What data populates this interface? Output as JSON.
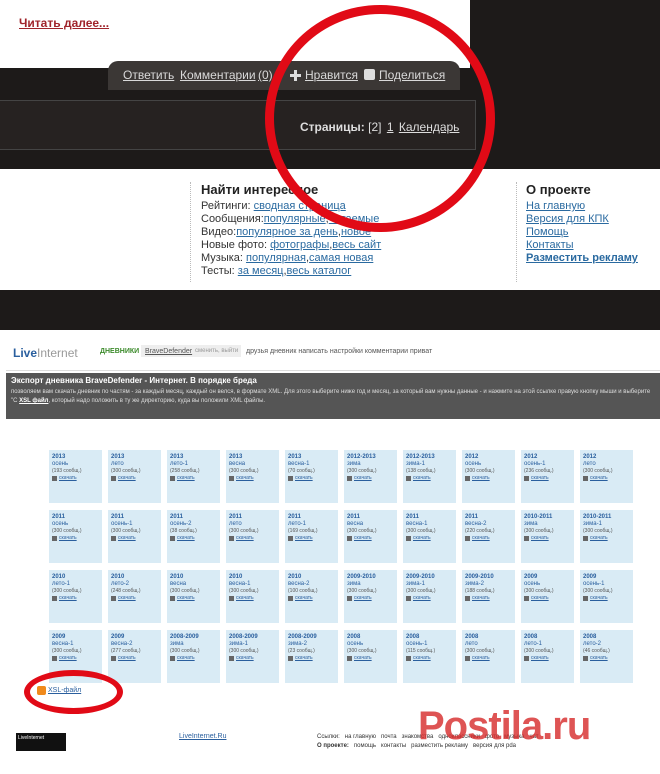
{
  "top": {
    "read_more": "Читать далее...",
    "actions": {
      "reply": "Ответить",
      "comments": "Комментарии",
      "count": "(0)",
      "like": "Нравится",
      "share": "Поделиться"
    },
    "pager": {
      "label": "Страницы:",
      "current": "[2]",
      "page1": "1",
      "calendar": "Календарь"
    },
    "find": {
      "title": "Найти интересное",
      "ratings_label": "Рейтинги:",
      "ratings_link": "сводная страница",
      "posts_label": "Сообщения:",
      "posts_link1": "популярные",
      "posts_link2": "читаемые",
      "video_label": "Видео:",
      "video_link1": "популярное за день",
      "video_link2": "новое",
      "photo_label": "Новые фото:",
      "photo_link1": "фотографы",
      "photo_link2": "весь сайт",
      "music_label": "Музыка:",
      "music_link1": "популярная",
      "music_link2": "самая новая",
      "tests_label": "Тесты:",
      "tests_link1": "за месяц",
      "tests_link2": "весь каталог"
    },
    "about": {
      "title": "О проекте",
      "items": [
        "На главную",
        "Версия для КПК",
        "Помощь",
        "Контакты",
        "Разместить рекламу"
      ]
    }
  },
  "li": {
    "logo_a": "Live",
    "logo_b": "Internet",
    "diaries": "ДНЕВНИКИ",
    "user": "BraveDefender",
    "exit": "сменить, выйти",
    "nav": "друзья дневник написать настройки комментарии приват",
    "export_title": "Экспорт дневника BraveDefender - Интернет. В порядке бреда",
    "export_desc_a": "позволяем вам скачать дневник по частям - за каждый месяц, каждый он велся, в формате XML. Для этого выберите ниже год и месяц, за который вам нужны данные - и нажмите на этой ссылке правую кнопку мыши и выберите \"С",
    "export_desc_b": "XSL файл",
    "export_desc_c": ", который надо положить в ту же директорию, куда вы положили XML файлы.",
    "xsl": "XSL-файл",
    "counter": "LiveInternet",
    "footer_link": "LiveInternet.Ru",
    "footer_row1": [
      "Ссылки:",
      "на главную",
      "почта",
      "знакомства",
      "одноклассники",
      "фото",
      "музыка",
      "чат"
    ],
    "footer_row2": [
      "О проекте:",
      "помощь",
      "контакты",
      "разместить рекламу",
      "версия для pda"
    ]
  },
  "grid": [
    [
      {
        "y": "2013",
        "s": "осень",
        "c": "(193 сообщ.)"
      },
      {
        "y": "2013",
        "s": "лето",
        "c": "(300 сообщ.)"
      },
      {
        "y": "2013",
        "s": "лето-1",
        "c": "(258 сообщ.)"
      },
      {
        "y": "2013",
        "s": "весна",
        "c": "(300 сообщ.)"
      },
      {
        "y": "2013",
        "s": "весна-1",
        "c": "(70 сообщ.)"
      },
      {
        "y": "2012-2013",
        "s": "зима",
        "c": "(300 сообщ.)"
      },
      {
        "y": "2012-2013",
        "s": "зима-1",
        "c": "(138 сообщ.)"
      },
      {
        "y": "2012",
        "s": "осень",
        "c": "(300 сообщ.)"
      },
      {
        "y": "2012",
        "s": "осень-1",
        "c": "(236 сообщ.)"
      },
      {
        "y": "2012",
        "s": "лето",
        "c": "(300 сообщ.)"
      },
      {
        "y": "2012",
        "s": "лето-1",
        "c": "(225 сообщ.)"
      }
    ],
    [
      {
        "y": "2011",
        "s": "осень",
        "c": "(300 сообщ.)"
      },
      {
        "y": "2011",
        "s": "осень-1",
        "c": "(300 сообщ.)"
      },
      {
        "y": "2011",
        "s": "осень-2",
        "c": "(38 сообщ.)"
      },
      {
        "y": "2011",
        "s": "лето",
        "c": "(300 сообщ.)"
      },
      {
        "y": "2011",
        "s": "лето-1",
        "c": "(169 сообщ.)"
      },
      {
        "y": "2011",
        "s": "весна",
        "c": "(300 сообщ.)"
      },
      {
        "y": "2011",
        "s": "весна-1",
        "c": "(300 сообщ.)"
      },
      {
        "y": "2011",
        "s": "весна-2",
        "c": "(220 сообщ.)"
      },
      {
        "y": "2010-2011",
        "s": "зима",
        "c": "(300 сообщ.)"
      },
      {
        "y": "2010-2011",
        "s": "зима-1",
        "c": "(300 сообщ.)"
      },
      {
        "y": "2010-2011",
        "s": "зима-2",
        "c": "(300 сообщ.)"
      }
    ],
    [
      {
        "y": "2010",
        "s": "лето-1",
        "c": "(300 сообщ.)"
      },
      {
        "y": "2010",
        "s": "лето-2",
        "c": "(248 сообщ.)"
      },
      {
        "y": "2010",
        "s": "весна",
        "c": "(300 сообщ.)"
      },
      {
        "y": "2010",
        "s": "весна-1",
        "c": "(300 сообщ.)"
      },
      {
        "y": "2010",
        "s": "весна-2",
        "c": "(100 сообщ.)"
      },
      {
        "y": "2009-2010",
        "s": "зима",
        "c": "(300 сообщ.)"
      },
      {
        "y": "2009-2010",
        "s": "зима-1",
        "c": "(300 сообщ.)"
      },
      {
        "y": "2009-2010",
        "s": "зима-2",
        "c": "(188 сообщ.)"
      },
      {
        "y": "2009",
        "s": "осень",
        "c": "(300 сообщ.)"
      },
      {
        "y": "2009",
        "s": "осень-1",
        "c": "(300 сообщ.)"
      },
      {
        "y": "2009",
        "s": "осень-2",
        "c": "(300 сообщ.)"
      }
    ],
    [
      {
        "y": "2009",
        "s": "весна-1",
        "c": "(300 сообщ.)"
      },
      {
        "y": "2009",
        "s": "весна-2",
        "c": "(277 сообщ.)"
      },
      {
        "y": "2008-2009",
        "s": "зима",
        "c": "(300 сообщ.)"
      },
      {
        "y": "2008-2009",
        "s": "зима-1",
        "c": "(300 сообщ.)"
      },
      {
        "y": "2008-2009",
        "s": "зима-2",
        "c": "(23 сообщ.)"
      },
      {
        "y": "2008",
        "s": "осень",
        "c": "(300 сообщ.)"
      },
      {
        "y": "2008",
        "s": "осень-1",
        "c": "(115 сообщ.)"
      },
      {
        "y": "2008",
        "s": "лето",
        "c": "(300 сообщ.)"
      },
      {
        "y": "2008",
        "s": "лето-1",
        "c": "(300 сообщ.)"
      },
      {
        "y": "2008",
        "s": "лето-2",
        "c": "(46 сообщ.)"
      },
      {
        "y": "2008",
        "s": "весна",
        "c": "(300 сообщ.)"
      }
    ]
  ],
  "download_label": "скачать",
  "watermark": "Postila.ru",
  "accent_red": "#e10a16"
}
